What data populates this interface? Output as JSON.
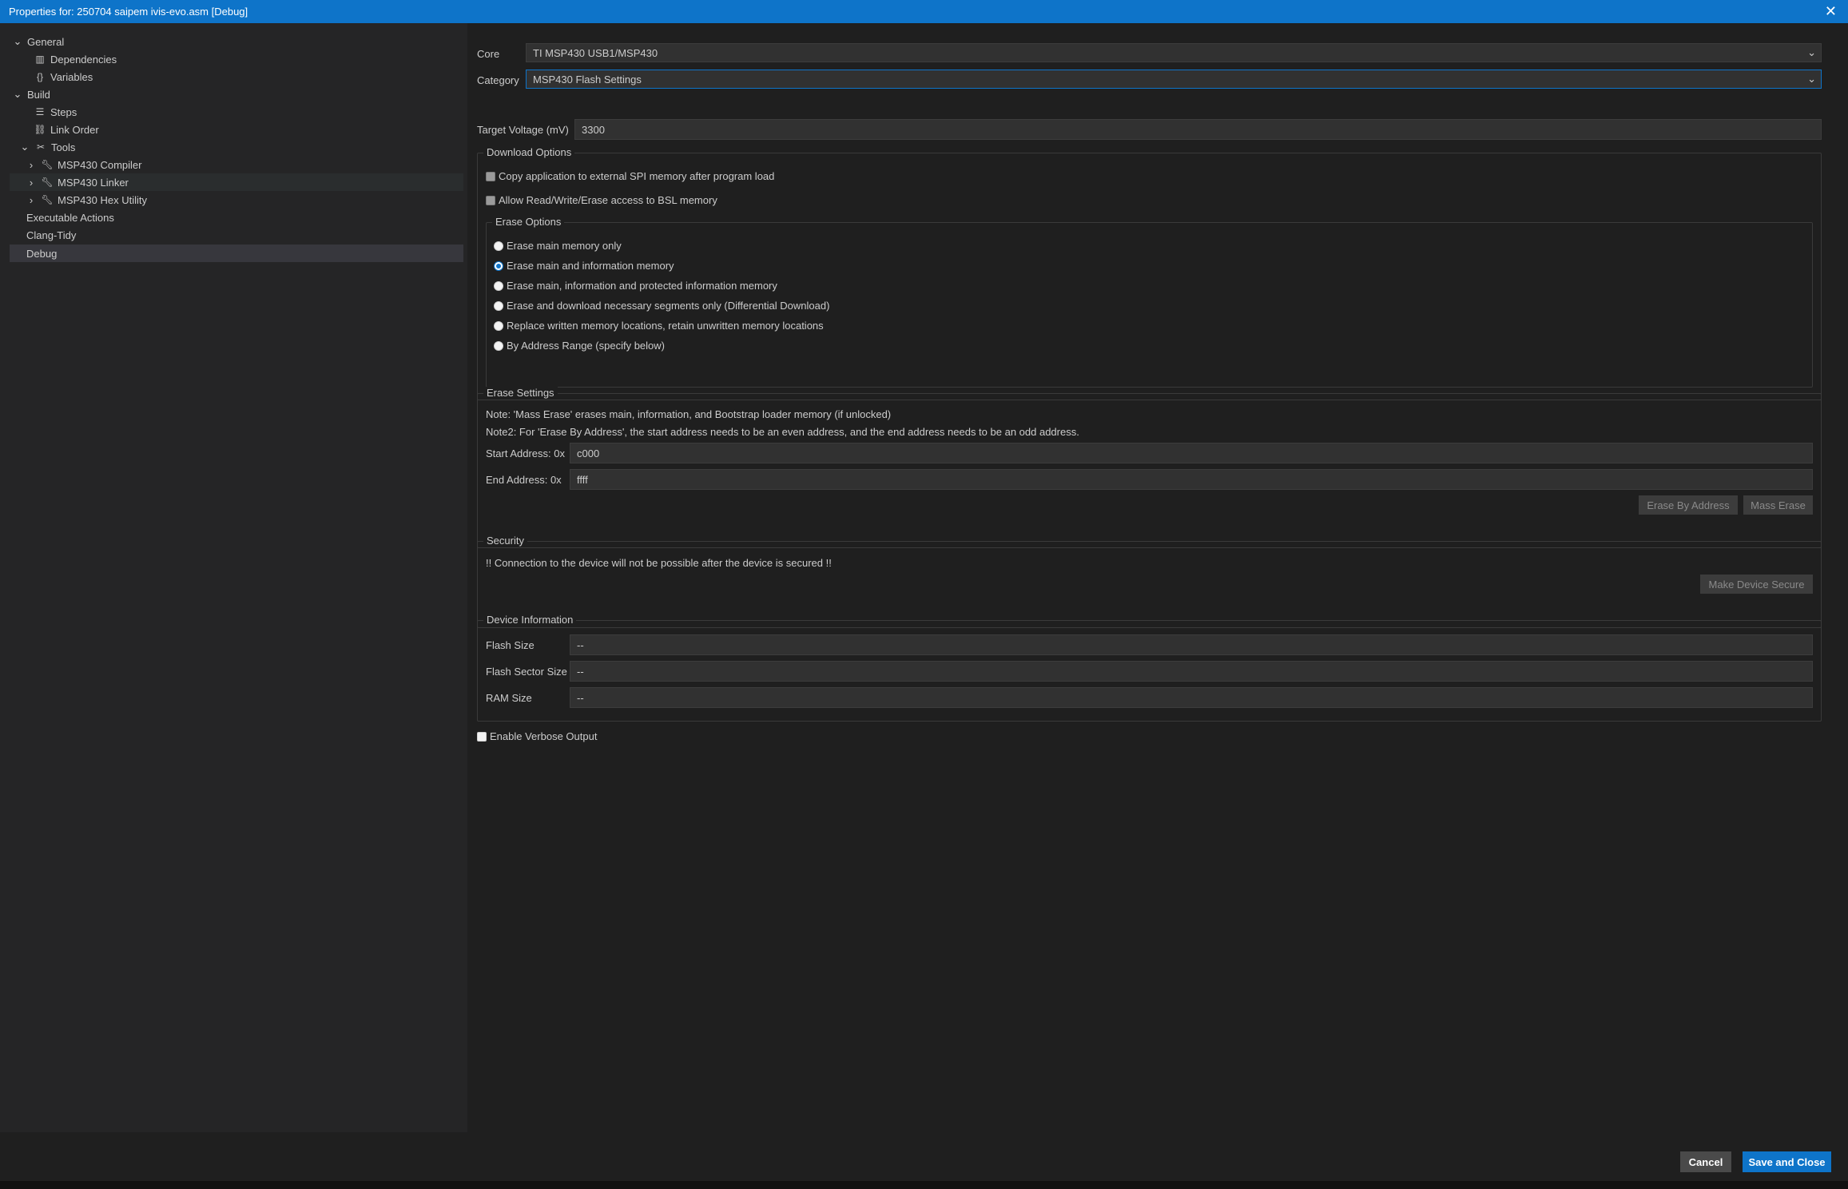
{
  "window": {
    "title": "Properties for: 250704 saipem ivis-evo.asm [Debug]",
    "close_glyph": "✕"
  },
  "sidebar": {
    "items": [
      {
        "label": "General",
        "icon": "chevron-down-icon"
      },
      {
        "label": "Dependencies",
        "icon": "library-icon"
      },
      {
        "label": "Variables",
        "icon": "braces-icon"
      },
      {
        "label": "Build",
        "icon": "chevron-down-icon"
      },
      {
        "label": "Steps",
        "icon": "list-icon"
      },
      {
        "label": "Link Order",
        "icon": "link-icon"
      },
      {
        "label": "Tools",
        "icon": "tools-icon"
      },
      {
        "label": "MSP430 Compiler",
        "icon": "wrench-icon"
      },
      {
        "label": "MSP430 Linker",
        "icon": "wrench-icon"
      },
      {
        "label": "MSP430 Hex Utility",
        "icon": "wrench-icon"
      },
      {
        "label": "Executable Actions"
      },
      {
        "label": "Clang-Tidy"
      },
      {
        "label": "Debug"
      }
    ],
    "selected": "Debug"
  },
  "form": {
    "core_label": "Core",
    "core_value": "TI MSP430 USB1/MSP430",
    "category_label": "Category",
    "category_value": "MSP430 Flash Settings",
    "target_voltage_label": "Target Voltage (mV)",
    "target_voltage_value": "3300"
  },
  "download_options": {
    "legend": "Download Options",
    "copy_spi_label": "Copy application to external SPI memory after program load",
    "bsl_access_label": "Allow Read/Write/Erase access to BSL memory",
    "erase_options": {
      "legend": "Erase Options",
      "options": [
        "Erase main memory only",
        "Erase main and information memory",
        "Erase main, information and protected information memory",
        "Erase and download necessary segments only (Differential Download)",
        "Replace written memory locations, retain unwritten memory locations",
        "By Address Range (specify below)"
      ],
      "selected": "Erase main and information memory"
    }
  },
  "erase_settings": {
    "legend": "Erase Settings",
    "note1": "Note: 'Mass Erase' erases main, information, and Bootstrap loader memory (if unlocked)",
    "note2": "Note2: For 'Erase By Address', the start address needs to be an even address, and the end address needs to be an odd address.",
    "start_label": "Start Address: 0x",
    "start_value": "c000",
    "end_label": "End Address: 0x",
    "end_value": "ffff",
    "erase_by_address_button": "Erase By Address",
    "mass_erase_button": "Mass Erase"
  },
  "security": {
    "legend": "Security",
    "warning": "!! Connection to the device will not be possible after the device is secured !!",
    "make_secure_button": "Make Device Secure"
  },
  "device_information": {
    "legend": "Device Information",
    "flash_size_label": "Flash Size",
    "flash_size_value": "--",
    "flash_sector_label": "Flash Sector Size",
    "flash_sector_value": "--",
    "ram_size_label": "RAM Size",
    "ram_size_value": "--"
  },
  "verbose_label": "Enable Verbose Output",
  "footer": {
    "cancel_label": "Cancel",
    "save_label": "Save and Close"
  },
  "colors": {
    "accent": "#0e74c9",
    "background": "#1f1f1f",
    "sidebar": "#252526",
    "input": "#313131"
  }
}
